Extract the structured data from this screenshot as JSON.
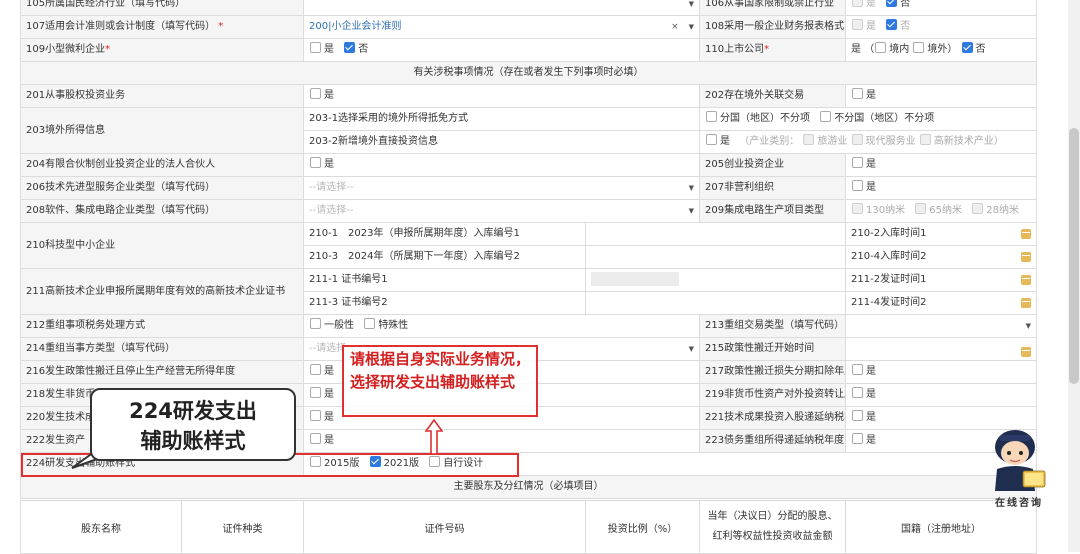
{
  "rows": {
    "r105": {
      "label": "105所属国民经济行业（填写代码）",
      "label2": "106从事国家限制或禁止行业",
      "yes": "是",
      "no": "否"
    },
    "r107": {
      "label": "107适用会计准则或会计制度（填写代码）",
      "value": "200|小企业会计准则",
      "clear": "×",
      "label2": "108采用一般企业财务报表格式（2019年版）",
      "yes": "是",
      "no": "否"
    },
    "r109": {
      "label": "109小型微利企业",
      "yes": "是",
      "no": "否",
      "label2": "110上市公司",
      "yes2": "是",
      "paren_open": "（",
      "domestic": "境内",
      "overseas": "境外",
      "paren_close": "）",
      "no2": "否"
    },
    "section_tax": "有关涉税事项情况（存在或者发生下列事项时必填）",
    "r201": {
      "label": "201从事股权投资业务",
      "yes": "是",
      "label2": "202存在境外关联交易",
      "yes2": "是"
    },
    "r203": {
      "label": "203境外所得信息",
      "sub1": "203-1选择采用的境外所得抵免方式",
      "opt1": "分国（地区）不分项",
      "opt2": "不分国（地区）不分项",
      "sub2": "203-2新增境外直接投资信息",
      "yes": "是",
      "industry_prefix": "（产业类别：",
      "ind1": "旅游业",
      "ind2": "现代服务业",
      "ind3": "高新技术产业",
      "industry_suffix": "）"
    },
    "r204": {
      "label": "204有限合伙制创业投资企业的法人合伙人",
      "yes": "是",
      "label2": "205创业投资企业",
      "yes2": "是"
    },
    "r206": {
      "label": "206技术先进型服务企业类型（填写代码）",
      "placeholder": "--请选择--",
      "label2": "207非营利组织",
      "yes2": "是"
    },
    "r208": {
      "label": "208软件、集成电路企业类型（填写代码）",
      "placeholder": "--请选择--",
      "label2": "209集成电路生产项目类型",
      "o1": "130纳米",
      "o2": "65纳米",
      "o3": "28纳米"
    },
    "r210": {
      "label": "210科技型中小企业",
      "sub1": "210-1　2023年（申报所属期年度）入库编号1",
      "sub2": "210-3　2024年（所属期下一年度）入库编号2",
      "time1": "210-2入库时间1",
      "time2": "210-4入库时间2"
    },
    "r211": {
      "label": "211高新技术企业申报所属期年度有效的高新技术企业证书",
      "sub1": "211-1 证书编号1",
      "sub2": "211-3 证书编号2",
      "time1": "211-2发证时间1",
      "time2": "211-4发证时间2"
    },
    "r212": {
      "label": "212重组事项税务处理方式",
      "opt1": "一般性",
      "opt2": "特殊性",
      "label2": "213重组交易类型（填写代码）"
    },
    "r214": {
      "label": "214重组当事方类型（填写代码）",
      "placeholder": "--请选择--",
      "label2": "215政策性搬迁开始时间"
    },
    "r216": {
      "label": "216发生政策性搬迁且停止生产经营无所得年度",
      "yes": "是",
      "label2": "217政策性搬迁损失分期扣除年度",
      "yes2": "是"
    },
    "r218": {
      "label": "218发生非货币",
      "yes": "是",
      "label2": "219非货币性资产对外投资转让所得递延纳税年度",
      "yes2": "是"
    },
    "r220": {
      "label": "220发生技术成",
      "yes": "是",
      "label2": "221技术成果投资入股递延纳税年度",
      "yes2": "是"
    },
    "r222": {
      "label": "222发生资产",
      "yes": "是",
      "label2": "223债务重组所得递延纳税年度",
      "yes2": "是"
    },
    "r224": {
      "label": "224研发支出辅助账样式",
      "opt1": "2015版",
      "opt2": "2021版",
      "opt3": "自行设计"
    },
    "section_shareholder": "主要股东及分红情况（必填项目）",
    "shareholder_headers": [
      "股东名称",
      "证件种类",
      "证件号码",
      "投资比例（%）",
      "当年（决议日）分配的股息、红利等权益性投资收益金额",
      "国籍（注册地址）"
    ]
  },
  "annotation": {
    "callout_text": "请根据自身实际业务情况，选择研发支出辅助账样式",
    "bubble_line1": "224研发支出",
    "bubble_line2": "辅助账样式",
    "mascot_text": "在线咨询",
    "colors": {
      "annotation_red": "#e03030",
      "checkbox_blue": "#2f7ae0",
      "calendar_gold": "#e7b85a"
    }
  }
}
